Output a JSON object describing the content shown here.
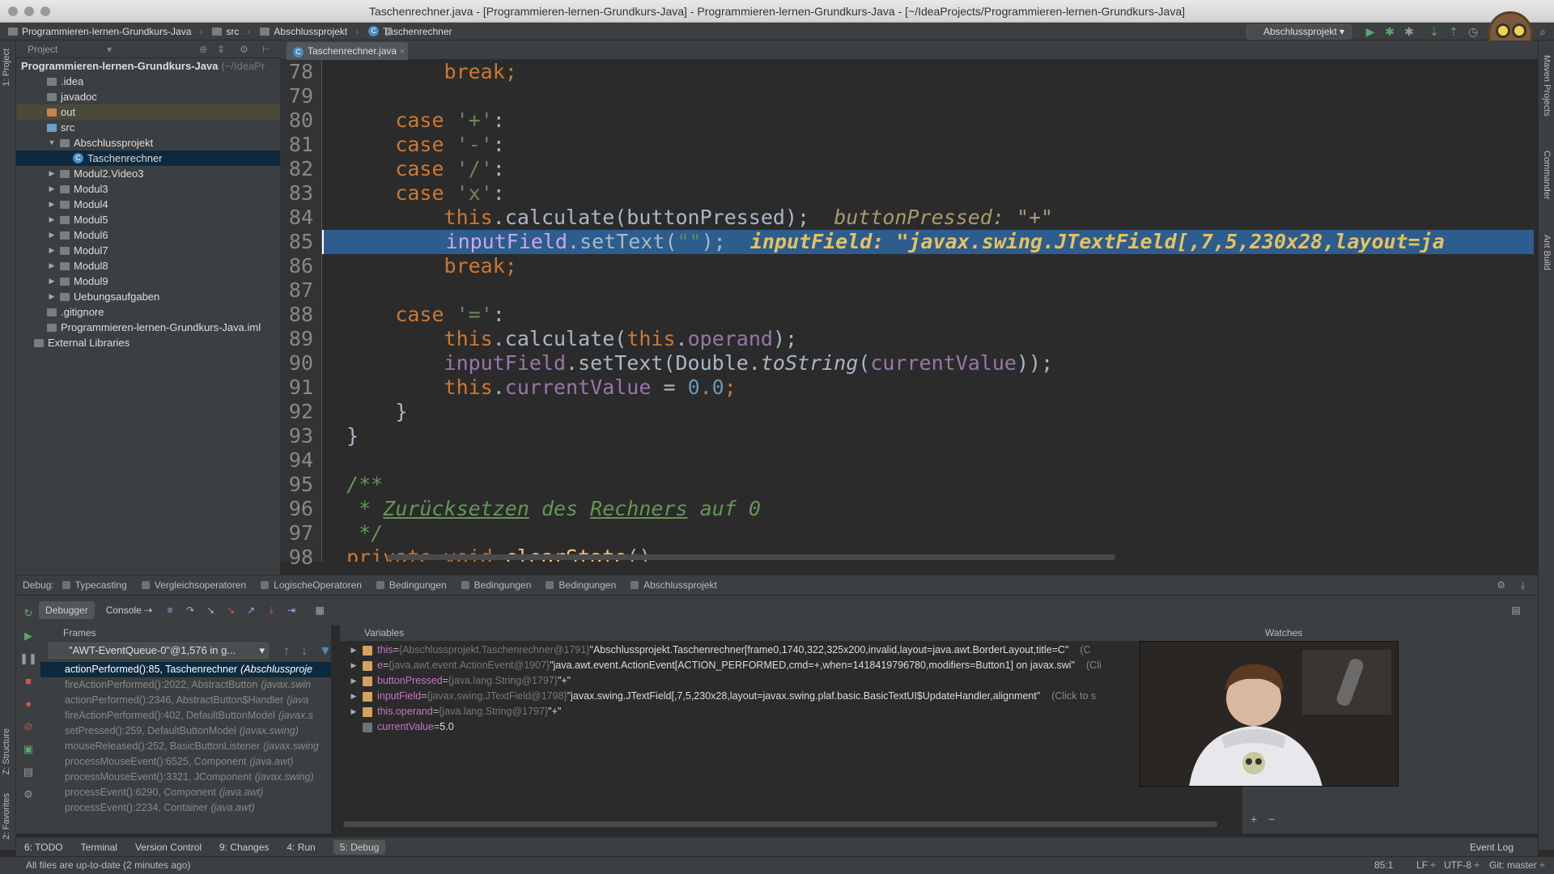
{
  "window": {
    "title": "Taschenrechner.java - [Programmieren-lernen-Grundkurs-Java] - Programmieren-lernen-Grundkurs-Java - [~/IdeaProjects/Programmieren-lernen-Grundkurs-Java]"
  },
  "breadcrumbs": [
    "Programmieren-lernen-Grundkurs-Java",
    "src",
    "Abschlussprojekt",
    "Taschenrechner"
  ],
  "toolbar": {
    "run_config": "Abschlussprojekt"
  },
  "side_labels": {
    "project": "1: Project",
    "structure": "Z: Structure",
    "favorites": "2: Favorites",
    "maven": "Maven Projects",
    "commander": "Commander",
    "ant": "Ant Build"
  },
  "project_panel": {
    "header": "Project",
    "root": "Programmieren-lernen-Grundkurs-Java",
    "root_path": "(~/IdeaPr",
    "items": [
      {
        "label": ".idea",
        "indent": 1,
        "arrow": ""
      },
      {
        "label": "javadoc",
        "indent": 1,
        "arrow": ""
      },
      {
        "label": "out",
        "indent": 1,
        "arrow": ""
      },
      {
        "label": "src",
        "indent": 1,
        "arrow": ""
      },
      {
        "label": "Abschlussprojekt",
        "indent": 2,
        "arrow": "▼"
      },
      {
        "label": "Taschenrechner",
        "indent": 3,
        "arrow": ""
      },
      {
        "label": "Modul2.Video3",
        "indent": 2,
        "arrow": "▶"
      },
      {
        "label": "Modul3",
        "indent": 2,
        "arrow": "▶"
      },
      {
        "label": "Modul4",
        "indent": 2,
        "arrow": "▶"
      },
      {
        "label": "Modul5",
        "indent": 2,
        "arrow": "▶"
      },
      {
        "label": "Modul6",
        "indent": 2,
        "arrow": "▶"
      },
      {
        "label": "Modul7",
        "indent": 2,
        "arrow": "▶"
      },
      {
        "label": "Modul8",
        "indent": 2,
        "arrow": "▶"
      },
      {
        "label": "Modul9",
        "indent": 2,
        "arrow": "▶"
      },
      {
        "label": "Uebungsaufgaben",
        "indent": 2,
        "arrow": "▶"
      },
      {
        "label": ".gitignore",
        "indent": 1,
        "arrow": ""
      },
      {
        "label": "Programmieren-lernen-Grundkurs-Java.iml",
        "indent": 1,
        "arrow": ""
      },
      {
        "label": "External Libraries",
        "indent": 0,
        "arrow": ""
      }
    ]
  },
  "editor": {
    "tab": "Taschenrechner.java",
    "line_numbers": [
      "78",
      "79",
      "80",
      "81",
      "82",
      "83",
      "84",
      "85",
      "86",
      "87",
      "88",
      "89",
      "90",
      "91",
      "92",
      "93",
      "94",
      "95",
      "96",
      "97",
      "98"
    ],
    "lines": {
      "l78": "break;",
      "l80_case": "case",
      "l80_val": "'+'",
      "l80_colon": ":",
      "l81_case": "case",
      "l81_val": "'-'",
      "l81_colon": ":",
      "l82_case": "case",
      "l82_val": "'/'",
      "l82_colon": ":",
      "l83_case": "case",
      "l83_val": "'x'",
      "l83_colon": ":",
      "l84_this": "this",
      "l84_rest": ".calculate(buttonPressed);",
      "l84_hint": "buttonPressed: \"+\"",
      "l85_field": "inputField",
      "l85_mid": ".setText(",
      "l85_str": "\"\"",
      "l85_end": ");",
      "l85_hint": "inputField: \"javax.swing.JTextField[,7,5,230x28,layout=ja",
      "l86": "break;",
      "l88_case": "case",
      "l88_val": "'='",
      "l88_colon": ":",
      "l89_this": "this",
      "l89_mid": ".calculate(",
      "l89_this2": "this",
      "l89_dot": ".",
      "l89_fld": "operand",
      "l89_end": ");",
      "l90_field": "inputField",
      "l90_mid": ".setText(Double.",
      "l90_method": "toString",
      "l90_open": "(",
      "l90_fld": "currentValue",
      "l90_end": "));",
      "l91_this": "this",
      "l91_dot": ".",
      "l91_fld": "currentValue",
      "l91_eq": " = ",
      "l91_num": "0.0",
      "l91_semi": ";",
      "l92": "}",
      "l93": "}",
      "l95": "/**",
      "l96_star": "* ",
      "l96_text": "Zurücksetzen",
      "l96_des": " des ",
      "l96_rech": "Rechners",
      "l96_auf": " auf 0",
      "l97": "*/",
      "l98_kw": "private void",
      "l98_name": "clearState",
      "l98_end": "()"
    }
  },
  "debug_tabs": {
    "label": "Debug:",
    "items": [
      "Typecasting",
      "Vergleichsoperatoren",
      "LogischeOperatoren",
      "Bedingungen",
      "Bedingungen",
      "Bedingungen",
      "Abschlussprojekt"
    ]
  },
  "debug_toolbar": {
    "debugger": "Debugger",
    "console": "Console"
  },
  "frames": {
    "header": "Frames",
    "thread": "\"AWT-EventQueue-0\"@1,576 in g...",
    "items": [
      {
        "method": "actionPerformed():85, Taschenrechner",
        "pkg": "(Abschlussproje"
      },
      {
        "method": "fireActionPerformed():2022, AbstractButton",
        "pkg": "(javax.swin"
      },
      {
        "method": "actionPerformed():2346, AbstractButton$Handler",
        "pkg": "(java"
      },
      {
        "method": "fireActionPerformed():402, DefaultButtonModel",
        "pkg": "(javax.s"
      },
      {
        "method": "setPressed():259, DefaultButtonModel",
        "pkg": "(javax.swing)"
      },
      {
        "method": "mouseReleased():252, BasicButtonListener",
        "pkg": "(javax.swing"
      },
      {
        "method": "processMouseEvent():6525, Component",
        "pkg": "(java.awt)"
      },
      {
        "method": "processMouseEvent():3321, JComponent",
        "pkg": "(javax.swing)"
      },
      {
        "method": "processEvent():6290, Component",
        "pkg": "(java.awt)"
      },
      {
        "method": "processEvent():2234, Container",
        "pkg": "(java.awt)"
      }
    ]
  },
  "variables": {
    "header": "Variables",
    "items": [
      {
        "name": "this",
        "type": "{Abschlussprojekt.Taschenrechner@1791}",
        "value": "\"Abschlussprojekt.Taschenrechner[frame0,1740,322,325x200,invalid,layout=java.awt.BorderLayout,title=C\"",
        "hint": "(C",
        "arrow": "▶"
      },
      {
        "name": "e",
        "type": "{java.awt.event.ActionEvent@1907}",
        "value": "\"java.awt.event.ActionEvent[ACTION_PERFORMED,cmd=+,when=1418419796780,modifiers=Button1] on javax.swi\"",
        "hint": "(Cli",
        "arrow": "▶"
      },
      {
        "name": "buttonPressed",
        "type": "{java.lang.String@1797}",
        "value": "\"+\"",
        "hint": "",
        "arrow": "▶"
      },
      {
        "name": "inputField",
        "type": "{javax.swing.JTextField@1798}",
        "value": "\"javax.swing.JTextField[,7,5,230x28,layout=javax.swing.plaf.basic.BasicTextUI$UpdateHandler,alignment\"",
        "hint": "(Click to s",
        "arrow": "▶"
      },
      {
        "name": "this.operand",
        "type": "{java.lang.String@1797}",
        "value": "\"+\"",
        "hint": "",
        "arrow": "▶"
      },
      {
        "name": "currentValue",
        "type": "",
        "value": "5.0",
        "hint": "",
        "arrow": ""
      }
    ]
  },
  "watches": {
    "header": "Watches"
  },
  "bottom_tabs": [
    {
      "label": "6: TODO",
      "active": false
    },
    {
      "label": "Terminal",
      "active": false
    },
    {
      "label": "Version Control",
      "active": false
    },
    {
      "label": "9: Changes",
      "active": false
    },
    {
      "label": "4: Run",
      "active": false
    },
    {
      "label": "5: Debug",
      "active": true
    }
  ],
  "event_log": "Event Log",
  "status": {
    "message": "All files are up-to-date (2 minutes ago)",
    "position": "85:1",
    "line_sep": "LF",
    "encoding": "UTF-8",
    "git": "Git: master"
  }
}
